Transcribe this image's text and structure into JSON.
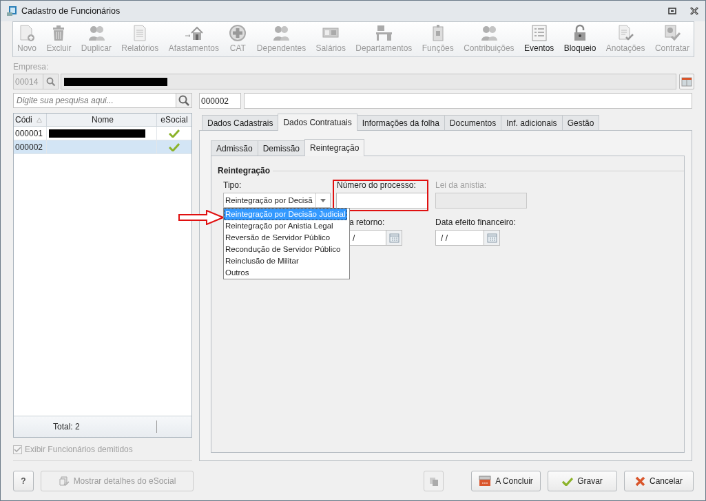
{
  "window": {
    "title": "Cadastro de Funcionários"
  },
  "toolbar": [
    {
      "label": "Novo",
      "disabled": true
    },
    {
      "label": "Excluir",
      "disabled": true
    },
    {
      "label": "Duplicar",
      "disabled": true
    },
    {
      "label": "Relatórios",
      "disabled": true
    },
    {
      "label": "Afastamentos",
      "disabled": true
    },
    {
      "label": "CAT",
      "disabled": true
    },
    {
      "label": "Dependentes",
      "disabled": true
    },
    {
      "label": "Salários",
      "disabled": true
    },
    {
      "label": "Departamentos",
      "disabled": true
    },
    {
      "label": "Funções",
      "disabled": true
    },
    {
      "label": "Contribuições",
      "disabled": true
    },
    {
      "label": "Eventos",
      "disabled": false
    },
    {
      "label": "Bloqueio",
      "disabled": false
    },
    {
      "label": "Anotações",
      "disabled": true
    },
    {
      "label": "Contratar",
      "disabled": true
    }
  ],
  "empresa": {
    "label": "Empresa:",
    "code": "00014"
  },
  "search": {
    "placeholder": "Digite sua pesquisa aqui..."
  },
  "employees": {
    "columns": [
      "Códi",
      "Nome",
      "eSocial"
    ],
    "rows": [
      {
        "code": "000001",
        "esocial": true,
        "selected": false
      },
      {
        "code": "000002",
        "esocial": true,
        "selected": true
      }
    ],
    "total": "Total: 2"
  },
  "show_dismissed": {
    "label": "Exibir Funcionários demitidos",
    "checked": true,
    "disabled": true
  },
  "record": {
    "code": "000002"
  },
  "main_tabs": [
    {
      "label": "Dados Cadastrais",
      "selected": false
    },
    {
      "label": "Dados Contratuais",
      "selected": true
    },
    {
      "label": "Informações da folha",
      "selected": false
    },
    {
      "label": "Documentos",
      "selected": false
    },
    {
      "label": "Inf. adicionais",
      "selected": false
    },
    {
      "label": "Gestão",
      "selected": false
    }
  ],
  "sub_tabs": [
    {
      "label": "Admissão",
      "selected": false
    },
    {
      "label": "Demissão",
      "selected": false
    },
    {
      "label": "Reintegração",
      "selected": true
    }
  ],
  "group": {
    "title": "Reintegração"
  },
  "tipo": {
    "label": "Tipo:",
    "value": "Reintegração por Decisã"
  },
  "numero_processo": {
    "label": "Número do processo:"
  },
  "lei_anistia": {
    "label": "Lei da anistia:",
    "disabled": true
  },
  "data_retorno": {
    "label": "a retorno:",
    "value": "/"
  },
  "data_efeito": {
    "label": "Data efeito financeiro:",
    "value": "/ /"
  },
  "tipo_options": [
    {
      "label": "Reintegração por Decisão Judicial",
      "selected": true
    },
    {
      "label": "Reintegração por Anistia Legal",
      "selected": false
    },
    {
      "label": "Reversão de Servidor Público",
      "selected": false
    },
    {
      "label": "Recondução de Servidor Público",
      "selected": false
    },
    {
      "label": "Reinclusão de Militar",
      "selected": false
    },
    {
      "label": "Outros",
      "selected": false
    }
  ],
  "buttons": {
    "help": "?",
    "details": {
      "label": "Mostrar detalhes do eSocial",
      "disabled": true
    },
    "concluir": "A Concluir",
    "gravar": "Gravar",
    "cancelar": "Cancelar"
  }
}
